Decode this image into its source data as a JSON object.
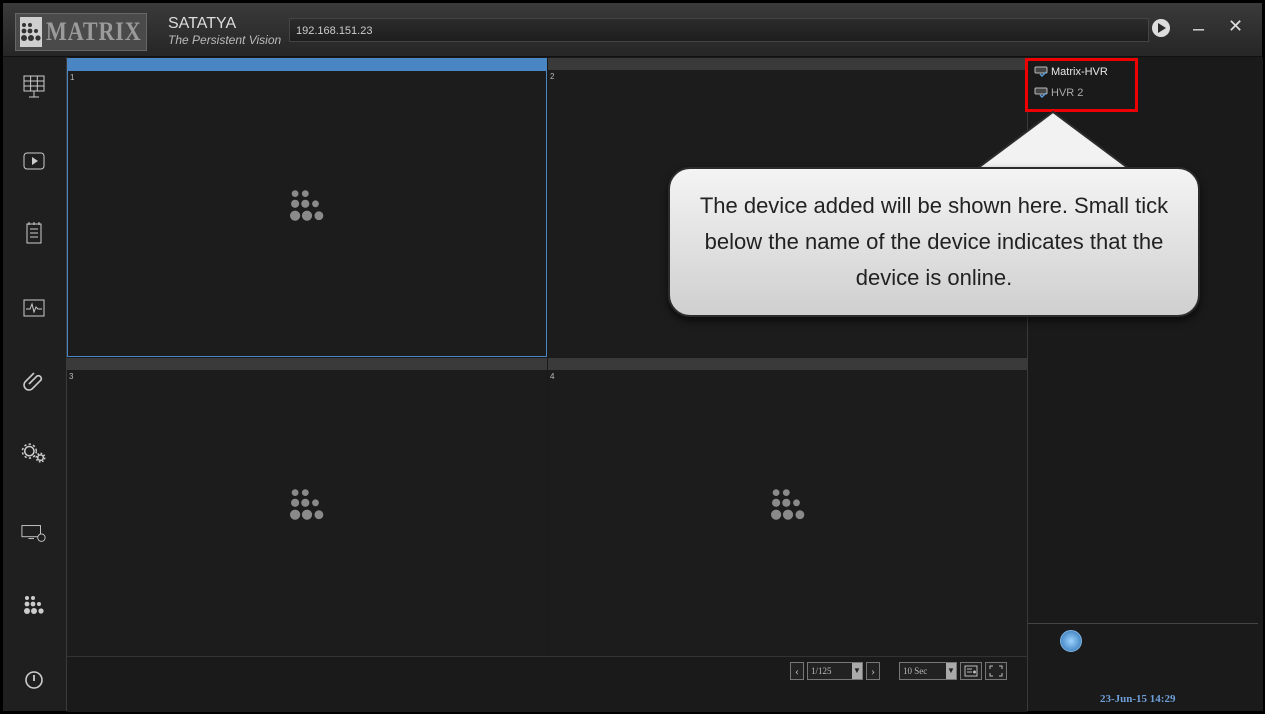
{
  "app": {
    "brand_name": "SATATYA",
    "tagline": "The Persistent Vision",
    "logo_text": "MATRIX"
  },
  "address_bar": {
    "value": "192.168.151.23"
  },
  "titlebar_buttons": [
    {
      "icon": "play-circle-icon"
    },
    {
      "label": "–"
    },
    {
      "label": "✕"
    }
  ],
  "sidebar": [
    {
      "icon": "live-view-grid-icon"
    },
    {
      "icon": "playback-icon"
    },
    {
      "icon": "event-log-icon"
    },
    {
      "icon": "health-monitor-icon"
    },
    {
      "icon": "attachment-icon"
    },
    {
      "icon": "settings-gears-icon"
    },
    {
      "icon": "display-settings-icon"
    },
    {
      "icon": "matrix-logo-icon"
    },
    {
      "icon": "power-icon"
    }
  ],
  "tiles": [
    {
      "number": "1",
      "active": true
    },
    {
      "number": "2",
      "active": false
    },
    {
      "number": "3",
      "active": false
    },
    {
      "number": "4",
      "active": false
    }
  ],
  "devices": [
    {
      "name": "Matrix-HVR",
      "status": "online"
    },
    {
      "name": "HVR 2",
      "status": "online"
    }
  ],
  "callout": {
    "text": "The device added will be shown here. Small tick below the name of the device indicates that the device is online."
  },
  "pager": {
    "page": "1/125",
    "interval": "10 Sec"
  },
  "datetime": "23-Jun-15 14:29",
  "colors": {
    "accent": "#4b86c4",
    "highlight": "#e00000",
    "background": "#1a1a1a"
  }
}
